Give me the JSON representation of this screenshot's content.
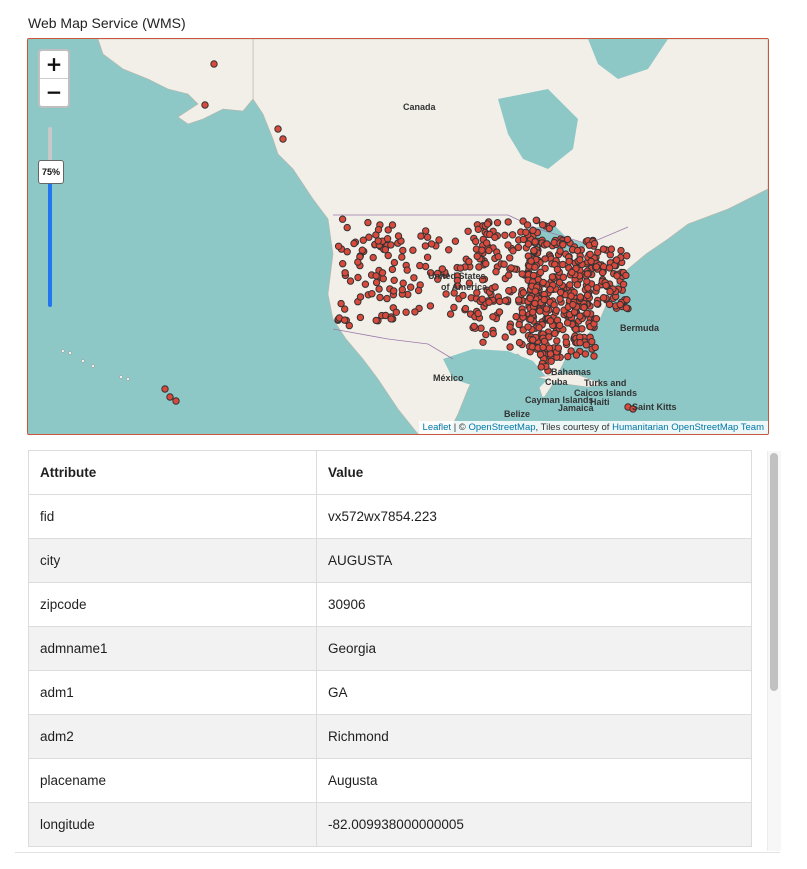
{
  "title": "Web Map Service (WMS)",
  "map": {
    "zoom_in": "+",
    "zoom_out": "−",
    "opacity": "75%",
    "labels": {
      "canada": "Canada",
      "united_states_1": "United States",
      "united_states_2": "of America",
      "mexico": "México",
      "bermuda": "Bermuda",
      "bahamas": "Bahamas",
      "cuba": "Cuba",
      "turks": "Turks and",
      "caicos": "Caicos Islands",
      "cayman": "Cayman Islands",
      "haiti": "Haiti",
      "jamaica": "Jamaica",
      "belize": "Belize",
      "st_kitts": "Saint Kitts"
    },
    "attribution": {
      "leaflet": "Leaflet",
      "sep": " | © ",
      "osm": "OpenStreetMap",
      "tiles": ", Tiles courtesy of ",
      "hot": "Humanitarian OpenStreetMap Team"
    },
    "colors": {
      "water": "#8dc8c7",
      "land": "#f2efe9",
      "point_fill": "#d94a3d",
      "point_stroke": "#333333"
    }
  },
  "table": {
    "headers": [
      "Attribute",
      "Value"
    ],
    "rows": [
      [
        "fid",
        "vx572wx7854.223"
      ],
      [
        "city",
        "AUGUSTA"
      ],
      [
        "zipcode",
        "30906"
      ],
      [
        "admname1",
        "Georgia"
      ],
      [
        "adm1",
        "GA"
      ],
      [
        "adm2",
        "Richmond"
      ],
      [
        "placename",
        "Augusta"
      ],
      [
        "longitude",
        "-82.009938000000005"
      ]
    ]
  }
}
